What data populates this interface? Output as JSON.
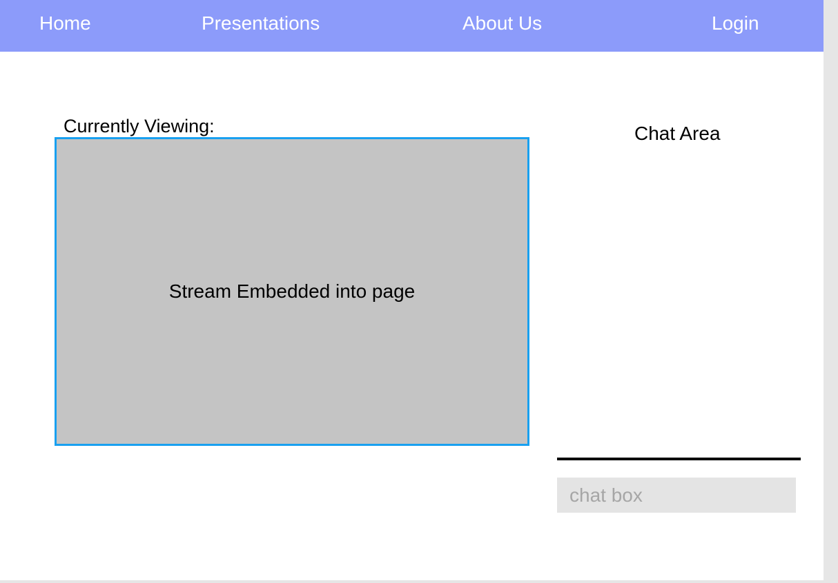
{
  "nav": {
    "home": "Home",
    "presentations": "Presentations",
    "about": "About Us",
    "login": "Login"
  },
  "viewer": {
    "label": "Currently Viewing:",
    "stream_text": "Stream Embedded into page"
  },
  "chat": {
    "title": "Chat Area",
    "input_placeholder": "chat box",
    "input_value": ""
  },
  "colors": {
    "navbar": "#8c9bfa",
    "stream_border": "#18a0f0",
    "stream_fill": "#c4c4c4",
    "chat_input_bg": "#e4e4e4"
  }
}
